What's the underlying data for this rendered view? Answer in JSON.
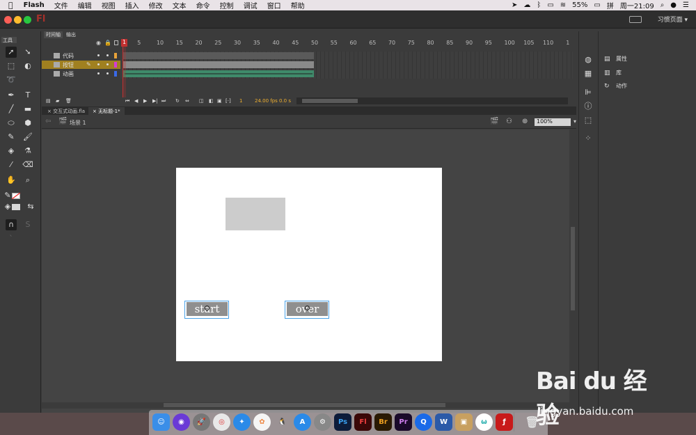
{
  "menubar": {
    "apple": "",
    "app_name": "Flash",
    "items": [
      "文件",
      "编辑",
      "视图",
      "插入",
      "修改",
      "文本",
      "命令",
      "控制",
      "调试",
      "窗口",
      "帮助"
    ],
    "battery": "55%",
    "clock": "周一21:09"
  },
  "window": {
    "logo": "Fl",
    "workspace": "习惯页面",
    "workspace_chevron": "▾"
  },
  "tools": {
    "tab_label": "工具"
  },
  "timeline": {
    "tabs": [
      "时间轴",
      "输出"
    ],
    "ruler": [
      "1",
      "5",
      "10",
      "15",
      "20",
      "25",
      "30",
      "35",
      "40",
      "45",
      "50",
      "55",
      "60",
      "65",
      "70",
      "75",
      "80",
      "85",
      "90",
      "95",
      "100",
      "105",
      "110",
      "1"
    ],
    "layers": [
      {
        "name": "代码",
        "color": "#e8a23a"
      },
      {
        "name": "按钮",
        "color": "#d63ad6"
      },
      {
        "name": "动画",
        "color": "#3a6ae8"
      }
    ],
    "current_frame": "1",
    "fps": "24.00 fps",
    "time": "0.0 s"
  },
  "documents": {
    "tabs": [
      "交互式动画.fla",
      "无标题-1*"
    ],
    "active_index": 1
  },
  "scene": {
    "name": "场景 1",
    "zoom": "100%"
  },
  "stage": {
    "buttons": [
      {
        "label": "start"
      },
      {
        "label": "over"
      }
    ]
  },
  "properties_panel": {
    "items": [
      "属性",
      "库",
      "动作"
    ]
  },
  "dock": {
    "apps": [
      "Ps",
      "Fl",
      "Br",
      "Pr",
      "W"
    ]
  },
  "watermark": {
    "logo": "Bai du 经验",
    "url": "jingyan.baidu.com"
  },
  "colors": {
    "accent_selection": "#4aa2e8",
    "layer_selected": "#a08020",
    "playhead": "#c03030"
  }
}
